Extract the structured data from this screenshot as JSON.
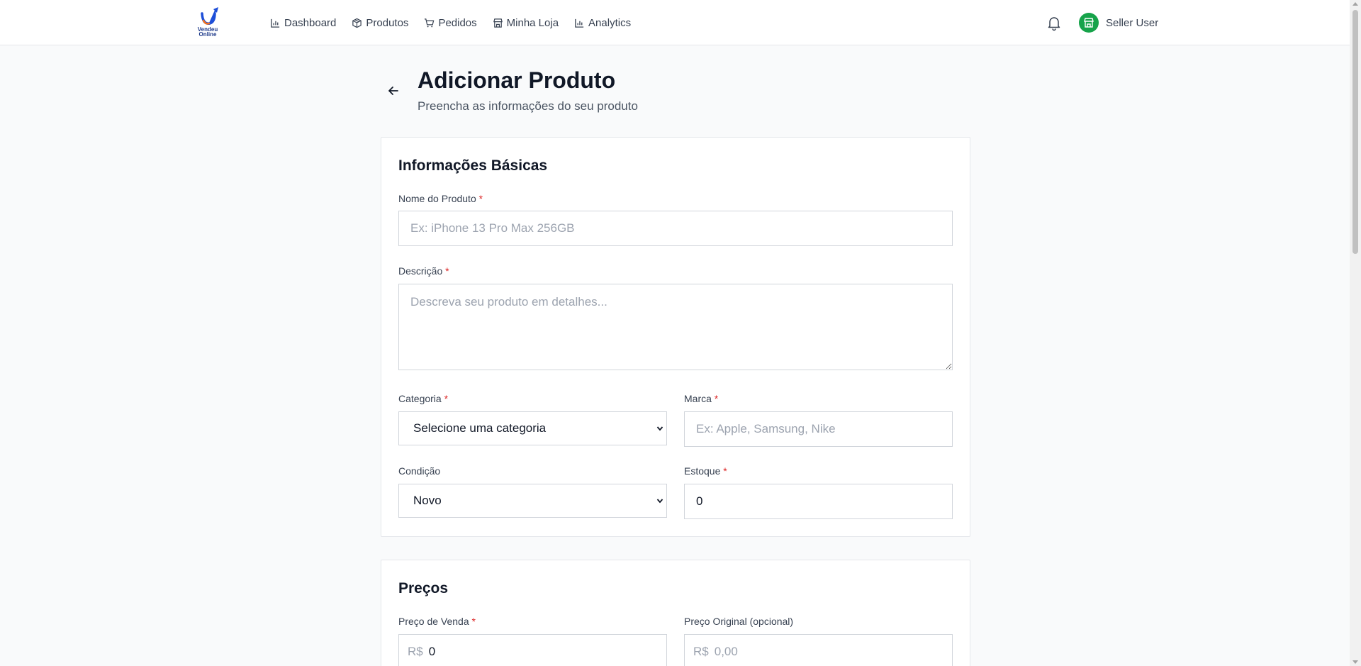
{
  "header": {
    "logo_text_line1": "Vendeu",
    "logo_text_line2": "Online",
    "nav": [
      {
        "label": "Dashboard",
        "icon": "bar-chart-icon"
      },
      {
        "label": "Produtos",
        "icon": "package-icon"
      },
      {
        "label": "Pedidos",
        "icon": "cart-icon"
      },
      {
        "label": "Minha Loja",
        "icon": "store-icon"
      },
      {
        "label": "Analytics",
        "icon": "bar-chart-icon"
      }
    ],
    "user_name": "Seller User"
  },
  "page": {
    "title": "Adicionar Produto",
    "subtitle": "Preencha as informações do seu produto"
  },
  "basic_info": {
    "title": "Informações Básicas",
    "name_label": "Nome do Produto",
    "name_placeholder": "Ex: iPhone 13 Pro Max 256GB",
    "description_label": "Descrição",
    "description_placeholder": "Descreva seu produto em detalhes...",
    "category_label": "Categoria",
    "category_value": "Selecione uma categoria",
    "brand_label": "Marca",
    "brand_placeholder": "Ex: Apple, Samsung, Nike",
    "condition_label": "Condição",
    "condition_value": "Novo",
    "stock_label": "Estoque",
    "stock_value": "0"
  },
  "pricing": {
    "title": "Preços",
    "sale_price_label": "Preço de Venda",
    "currency": "R$",
    "sale_price_value": "0",
    "original_price_label": "Preço Original (opcional)",
    "original_price_placeholder": "0,00"
  },
  "required_marker": "*",
  "colors": {
    "accent": "#16a34a",
    "required": "#dc2626",
    "background": "#f9fafb"
  }
}
